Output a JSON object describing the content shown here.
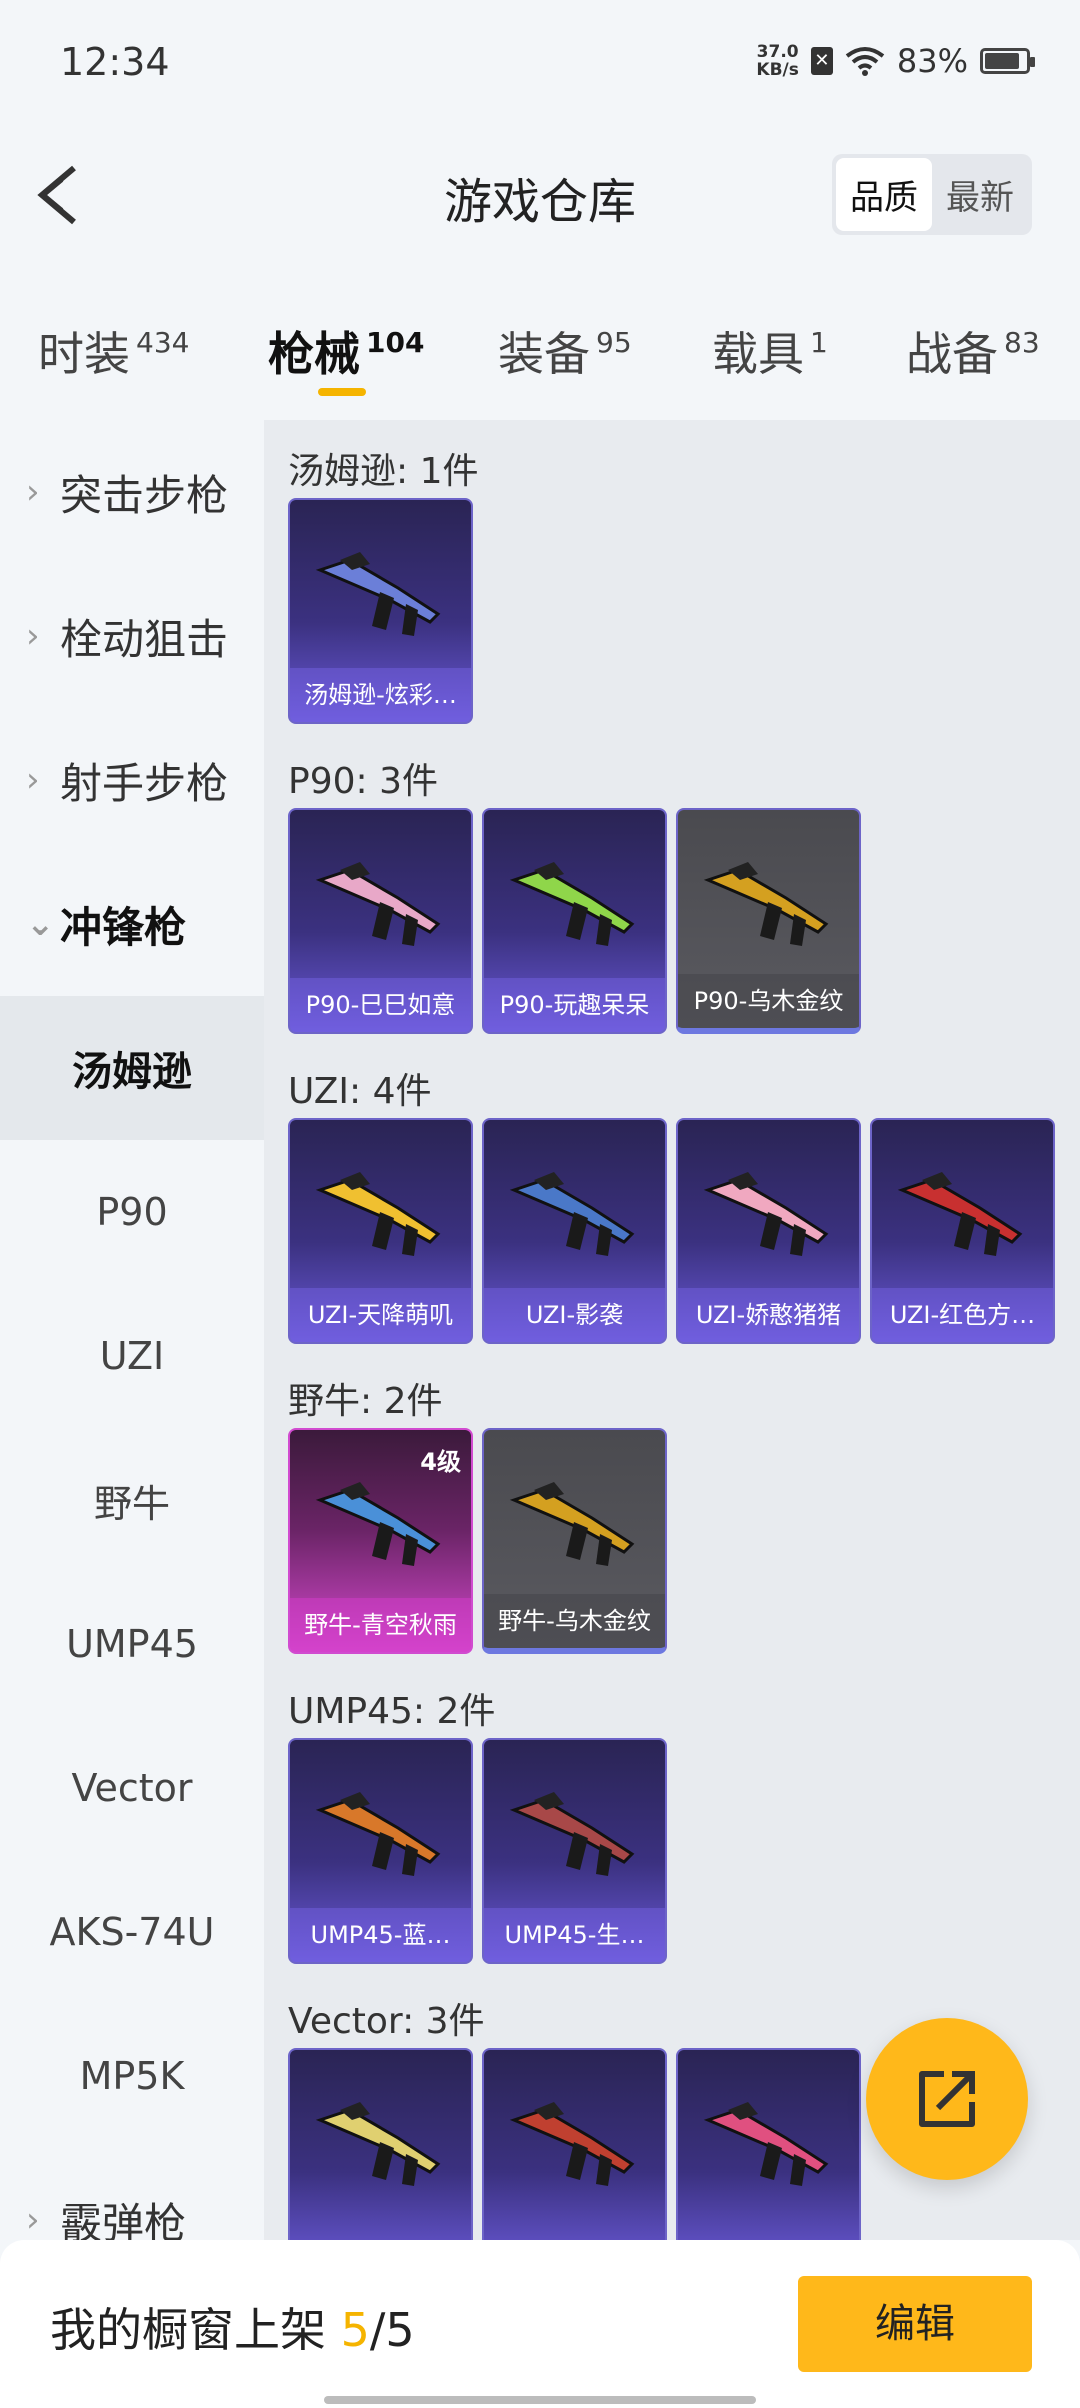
{
  "status": {
    "time": "12:34",
    "speed_top": "37.0",
    "speed_unit": "KB/s",
    "battery": "83%"
  },
  "header": {
    "title": "游戏仓库",
    "sort_quality": "品质",
    "sort_newest": "最新"
  },
  "tabs": [
    {
      "label": "时装",
      "count": "434"
    },
    {
      "label": "枪械",
      "count": "104"
    },
    {
      "label": "装备",
      "count": "95"
    },
    {
      "label": "载具",
      "count": "1"
    },
    {
      "label": "战备",
      "count": "83"
    }
  ],
  "sidebar": {
    "categories": [
      {
        "label": "突击步枪",
        "chevron": "›"
      },
      {
        "label": "栓动狙击",
        "chevron": "›"
      },
      {
        "label": "射手步枪",
        "chevron": "›"
      },
      {
        "label": "冲锋枪",
        "chevron": "⌄"
      },
      {
        "label": "霰弹枪",
        "chevron": "›"
      }
    ],
    "subitems": [
      {
        "label": "汤姆逊"
      },
      {
        "label": "P90"
      },
      {
        "label": "UZI"
      },
      {
        "label": "野牛"
      },
      {
        "label": "UMP45"
      },
      {
        "label": "Vector"
      },
      {
        "label": "AKS-74U"
      },
      {
        "label": "MP5K"
      }
    ]
  },
  "groups": [
    {
      "title": "汤姆逊: 1件",
      "items": [
        {
          "name": "汤姆逊-炫彩…",
          "rarity": "purple",
          "gun_color": "#6b7fd8"
        }
      ]
    },
    {
      "title": "P90: 3件",
      "items": [
        {
          "name": "P90-巳巳如意",
          "rarity": "purple",
          "gun_color": "#e8a8c8"
        },
        {
          "name": "P90-玩趣呆呆",
          "rarity": "purple",
          "gun_color": "#8fd64a"
        },
        {
          "name": "P90-乌木金纹",
          "rarity": "grey",
          "gun_color": "#d4a020"
        }
      ]
    },
    {
      "title": "UZI: 4件",
      "items": [
        {
          "name": "UZI-天降萌叽",
          "rarity": "purple",
          "gun_color": "#f0c030"
        },
        {
          "name": "UZI-影袭",
          "rarity": "purple",
          "gun_color": "#4a78c8"
        },
        {
          "name": "UZI-娇憨猪猪",
          "rarity": "purple",
          "gun_color": "#f0a8c0"
        },
        {
          "name": "UZI-红色方…",
          "rarity": "purple",
          "gun_color": "#c83030"
        }
      ]
    },
    {
      "title": "野牛: 2件",
      "items": [
        {
          "name": "野牛-青空秋雨",
          "rarity": "pink",
          "gun_color": "#4a90d8",
          "level": "4级"
        },
        {
          "name": "野牛-乌木金纹",
          "rarity": "grey",
          "gun_color": "#d4a020"
        }
      ]
    },
    {
      "title": "UMP45: 2件",
      "items": [
        {
          "name": "UMP45-蓝…",
          "rarity": "purple",
          "gun_color": "#d8782a"
        },
        {
          "name": "UMP45-生…",
          "rarity": "purple",
          "gun_color": "#a84848"
        }
      ]
    },
    {
      "title": "Vector: 3件",
      "items": [
        {
          "name": "",
          "rarity": "purple",
          "gun_color": "#e0d070"
        },
        {
          "name": "",
          "rarity": "purple",
          "gun_color": "#c04030"
        },
        {
          "name": "",
          "rarity": "purple",
          "gun_color": "#e05080"
        }
      ]
    }
  ],
  "bottom": {
    "prefix": "我的橱窗上架 ",
    "current": "5",
    "total": "/5",
    "edit_label": "编辑"
  },
  "colors": {
    "accent": "#ffb81a",
    "purple": "#6d64c8",
    "pink": "#d84ad0"
  }
}
